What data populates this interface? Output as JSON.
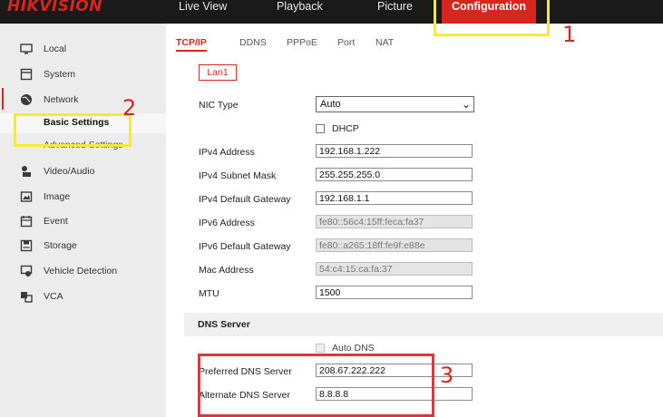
{
  "brand": "HIKVISION",
  "top_nav": {
    "live_view": "Live View",
    "playback": "Playback",
    "picture": "Picture",
    "configuration": "Configuration"
  },
  "sidebar": {
    "items": [
      {
        "label": "Local",
        "icon": "monitor-icon"
      },
      {
        "label": "System",
        "icon": "system-icon"
      },
      {
        "label": "Network",
        "icon": "globe-icon"
      },
      {
        "label": "Video/Audio",
        "icon": "video-audio-icon"
      },
      {
        "label": "Image",
        "icon": "image-icon"
      },
      {
        "label": "Event",
        "icon": "event-icon"
      },
      {
        "label": "Storage",
        "icon": "storage-icon"
      },
      {
        "label": "Vehicle Detection",
        "icon": "vehicle-detection-icon"
      },
      {
        "label": "VCA",
        "icon": "vca-icon"
      }
    ],
    "network_sub": {
      "basic": "Basic Settings",
      "advanced": "Advanced Settings"
    }
  },
  "tabs": [
    "TCP/IP",
    "DDNS",
    "PPPoE",
    "Port",
    "NAT"
  ],
  "subtab": "Lan1",
  "form": {
    "nic_type_label": "NIC Type",
    "nic_type_value": "Auto",
    "dhcp_label": "DHCP",
    "ipv4_address_label": "IPv4 Address",
    "ipv4_address": "192.168.1.222",
    "ipv4_mask_label": "IPv4 Subnet Mask",
    "ipv4_mask": "255.255.255.0",
    "ipv4_gateway_label": "IPv4 Default Gateway",
    "ipv4_gateway": "192.168.1.1",
    "ipv6_address_label": "IPv6 Address",
    "ipv6_address": "fe80::56c4:15ff:feca:fa37",
    "ipv6_gateway_label": "IPv6 Default Gateway",
    "ipv6_gateway": "fe80::a265:18ff:fe9f:e88e",
    "mac_label": "Mac Address",
    "mac": "54:c4:15:ca:fa:37",
    "mtu_label": "MTU",
    "mtu": "1500"
  },
  "dns": {
    "title": "DNS Server",
    "auto_label": "Auto DNS",
    "preferred_label": "Preferred DNS Server",
    "preferred": "208.67.222.222",
    "alternate_label": "Alternate DNS Server",
    "alternate": "8.8.8.8"
  },
  "annotations": {
    "step1": "1",
    "step2": "2",
    "step3": "3"
  },
  "colors": {
    "accent": "#d7261e",
    "highlight_yellow": "#f4ea37",
    "highlight_red": "#d7393c"
  }
}
